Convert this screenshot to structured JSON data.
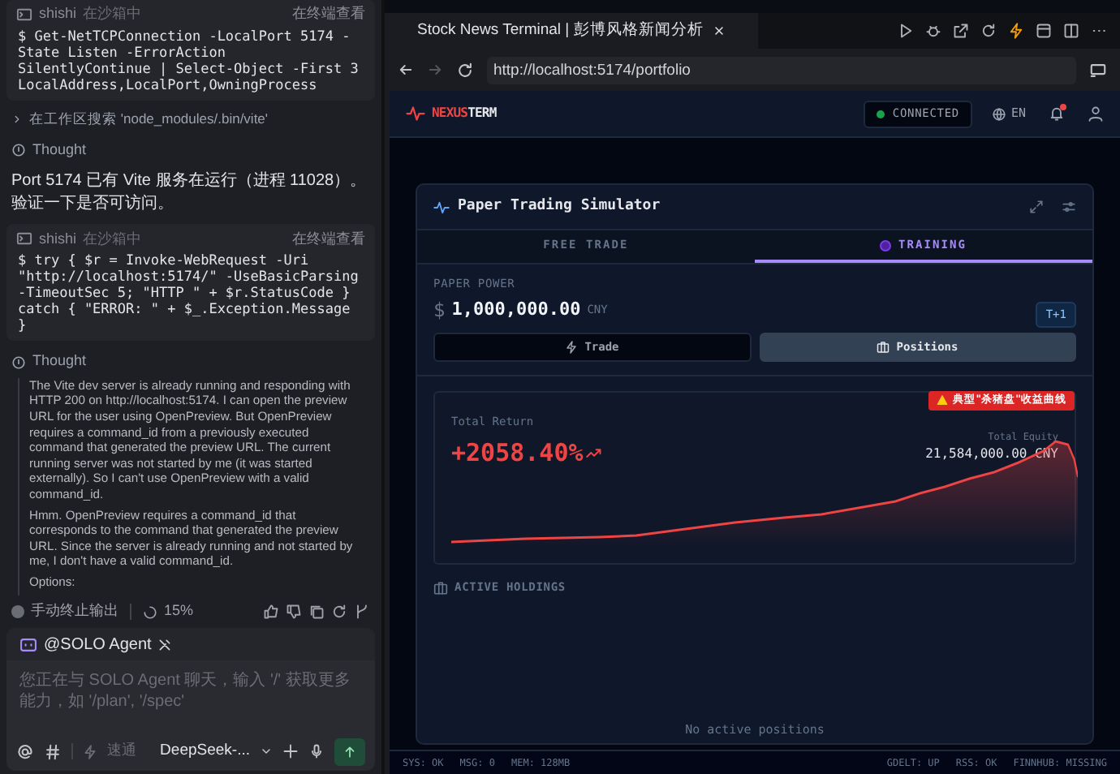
{
  "chat": {
    "blocks": [
      {
        "kind": "command",
        "user": "shishi",
        "sandbox": "在沙箱中",
        "view": "在终端查看",
        "code": "$ Get-NetTCPConnection -LocalPort 5174 -State Listen -ErrorAction SilentlyContinue | Select-Object -First 3 LocalAddress,LocalPort,OwningProcess"
      },
      {
        "kind": "search",
        "text": "在工作区搜索 'node_modules/.bin/vite'"
      },
      {
        "kind": "thought",
        "text": "Thought"
      },
      {
        "kind": "message",
        "text": "Port 5174 已有 Vite 服务在运行（进程 11028）。验证一下是否可访问。"
      },
      {
        "kind": "command",
        "user": "shishi",
        "sandbox": "在沙箱中",
        "view": "在终端查看",
        "code": "$ try { $r = Invoke-WebRequest -Uri \"http://localhost:5174/\" -UseBasicParsing -TimeoutSec 5; \"HTTP \" + $r.StatusCode } catch { \"ERROR: \" + $_.Exception.Message }"
      },
      {
        "kind": "thought",
        "text": "Thought"
      },
      {
        "kind": "thinking",
        "paragraphs": [
          "The Vite dev server is already running and responding with HTTP 200 on http://localhost:5174. I can open the preview URL for the user using OpenPreview. But OpenPreview requires a command_id from a previously executed command that generated the preview URL. The current running server was not started by me (it was started externally). So I can't use OpenPreview with a valid command_id.",
          "Hmm. OpenPreview requires a command_id that corresponds to the command that generated the preview URL. Since the server is already running and not started by me, I don't have a valid command_id.",
          "Options:"
        ]
      }
    ],
    "stop": "手动终止输出",
    "progress": "15%",
    "agent": "@SOLO Agent",
    "placeholder": "您正在与 SOLO Agent 聊天，输入 '/' 获取更多能力，如 '/plan', '/spec'",
    "speed": "速通",
    "model": "DeepSeek-..."
  },
  "browser": {
    "tab_title": "Stock News Terminal | 彭博风格新闻分析",
    "url": "http://localhost:5174/portfolio",
    "app": {
      "logo_a": "NEXUS",
      "logo_b": "TERM",
      "status": {
        "label": "CONNECTED",
        "on": true
      },
      "language": "EN",
      "notification": true,
      "panel_title": "Paper Trading Simulator",
      "tabs": [
        {
          "label": "FREE TRADE",
          "selected": false
        },
        {
          "label": "TRAINING",
          "selected": true
        }
      ],
      "power_label": "PAPER POWER",
      "currency_symbol": "$",
      "power": "1,000,000.00",
      "currency": "CNY",
      "badge": "T+1",
      "actions": [
        {
          "label": "Trade",
          "kind": "trade",
          "selected": false
        },
        {
          "label": "Positions",
          "kind": "positions",
          "selected": true
        }
      ],
      "return_label": "Total Return",
      "return_value": "+2058.40%",
      "warning": "典型\"杀猪盘\"收益曲线",
      "equity_label": "Total Equity",
      "equity": "21,584,000.00 CNY",
      "holdings_title": "ACTIVE HOLDINGS",
      "empty": "No active positions"
    },
    "status_left": [
      "SYS: OK",
      "MSG: 0",
      "MEM: 128MB"
    ],
    "status_right": [
      "GDELT: UP",
      "RSS: OK",
      "FINNHUB: MISSING"
    ]
  }
}
